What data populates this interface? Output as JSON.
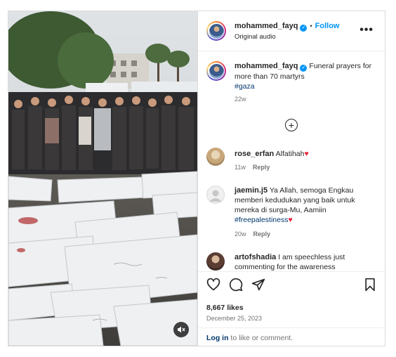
{
  "post": {
    "username": "mohammed_fayq",
    "follow_label": "Follow",
    "dot_separator": "•",
    "audio_label": "Original audio",
    "more_label": "•••",
    "caption": "Funeral prayers for more than 70 martyrs",
    "hashtag": "#gaza",
    "caption_age": "22w"
  },
  "comments": [
    {
      "username": "rose_erfan",
      "text": "Alfatihah",
      "emoji": "♥",
      "age": "11w",
      "reply": "Reply"
    },
    {
      "username": "jaemin.j5",
      "text": "Ya Allah, semoga Engkau memberi kedudukan yang baik untuk mereka di surga-Mu, Aamiin",
      "hashtag": "#freepalestiness",
      "emoji": "♥",
      "age": "20w",
      "reply": "Reply"
    },
    {
      "username": "artofshadia",
      "text": "I am speechless just commenting for the awareness"
    }
  ],
  "stats": {
    "likes": "8,667 likes",
    "date": "December 25, 2023"
  },
  "login": {
    "link": "Log in",
    "rest": "to like or comment."
  },
  "icons": {
    "verified": "✓",
    "load_more": "+",
    "heart": "heart-icon",
    "comment": "comment-icon",
    "share": "share-icon",
    "save": "bookmark-icon",
    "mute": "speaker-muted-icon"
  },
  "colors": {
    "accent": "#0095f6",
    "hashtag": "#00376b",
    "muted_text": "#737373",
    "border": "#dbdbdb"
  }
}
